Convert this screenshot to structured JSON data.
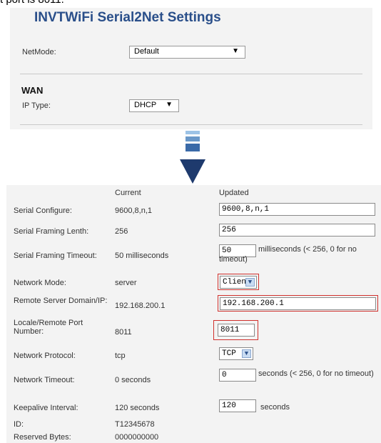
{
  "caption": "t port is 8011.",
  "top_panel": {
    "title": "INVTWiFi Serial2Net Settings",
    "netmode_label": "NetMode:",
    "netmode_value": "Default",
    "wan_heading": "WAN",
    "iptype_label": "IP Type:",
    "iptype_value": "DHCP"
  },
  "arrow": {
    "colors": [
      "#9dc3e6",
      "#6a98c9",
      "#3a6aa8",
      "#1e3a6d"
    ]
  },
  "table": {
    "header_current": "Current",
    "header_updated": "Updated",
    "rows": {
      "serial_configure": {
        "label": "Serial Configure:",
        "current": "9600,8,n,1",
        "value": "9600,8,n,1"
      },
      "framing_length": {
        "label": "Serial Framing Lenth:",
        "current": "256",
        "value": "256"
      },
      "framing_timeout": {
        "label": "Serial Framing Timeout:",
        "current": "50 milliseconds",
        "value": "50",
        "suffix": "milliseconds (< 256, 0 for no timeout)"
      },
      "network_mode": {
        "label": "Network Mode:",
        "current": "server",
        "value": "Client"
      },
      "remote_server": {
        "label": "Remote Server Domain/IP:",
        "current": "192.168.200.1",
        "value": "192.168.200.1"
      },
      "port": {
        "label": "Locale/Remote Port Number:",
        "current": "8011",
        "value": "8011"
      },
      "protocol": {
        "label": "Network Protocol:",
        "current": "tcp",
        "value": "TCP"
      },
      "network_timeout": {
        "label": "Network Timeout:",
        "current": "0 seconds",
        "value": "0",
        "suffix": "seconds (< 256, 0 for no timeout)"
      },
      "keepalive": {
        "label": "Keepalive Interval:",
        "current": "120 seconds",
        "value": "120",
        "suffix": "seconds"
      },
      "id": {
        "label": "ID:",
        "current": "T12345678"
      },
      "reserved": {
        "label": "Reserved Bytes:",
        "current": "0000000000"
      }
    }
  },
  "highlight_color": "#d0312d"
}
